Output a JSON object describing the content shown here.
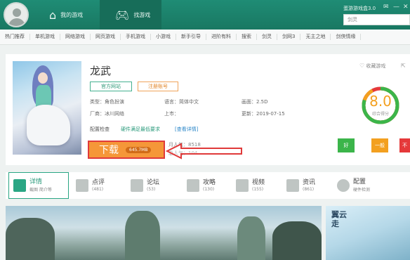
{
  "header": {
    "nav_my_games": "我的游戏",
    "nav_find_games": "找游戏",
    "version": "蛋游游戏盒3.0",
    "search_placeholder": "剑灵"
  },
  "categories": [
    "热门推荐",
    "单机游戏",
    "网络游戏",
    "网页游戏",
    "手机游戏",
    "小游戏",
    "新手引导",
    "进阶有料",
    "搜索",
    "剑灵",
    "剑网3",
    "无主之地",
    "剑侠情缘"
  ],
  "game": {
    "title": "龙武",
    "official_site": "官方网站",
    "register": "注册账号",
    "type_label": "类型：",
    "type_value": "角色扮演",
    "language_label": "语言：",
    "language_value": "简体中文",
    "graphics_label": "画面：",
    "graphics_value": "2.5D",
    "vendor_label": "厂商：",
    "vendor_value": "冰川网络",
    "launch_label": "上市：",
    "launch_value": "",
    "update_label": "更新：",
    "update_value": "2019-07-15",
    "config_check": "配置检查",
    "meets_req": "硬件满足最低要求",
    "view_details": "[查看详情]",
    "download_label": "下载",
    "download_size": "645.7MB",
    "monthly_pop_label": "月人气：",
    "monthly_pop_value": "8518",
    "total_pop_label": "总人气：",
    "total_pop_value": "104..."
  },
  "side": {
    "favorite": "收藏游戏",
    "score": "8.0",
    "score_caption": "综合得分",
    "rating_good": "好",
    "rating_ok": "一般",
    "rating_bad": "不"
  },
  "tabs": [
    {
      "name": "详情",
      "sub": "截图 简介等"
    },
    {
      "name": "点评",
      "sub": "(481)"
    },
    {
      "name": "论坛",
      "sub": "(53)"
    },
    {
      "name": "攻略",
      "sub": "(130)"
    },
    {
      "name": "视频",
      "sub": "(155)"
    },
    {
      "name": "资讯",
      "sub": "(861)"
    },
    {
      "name": "配置",
      "sub": "硬件检测"
    }
  ],
  "screenshot_text": "翼云走",
  "colors": {
    "header": "#1f8c75",
    "accent_green": "#2aa684",
    "download_orange": "#f59738",
    "highlight_red": "#e03a3a",
    "score_orange": "#f3a020",
    "good": "#3bb54a",
    "ok": "#f3a020",
    "bad": "#e5393a"
  }
}
